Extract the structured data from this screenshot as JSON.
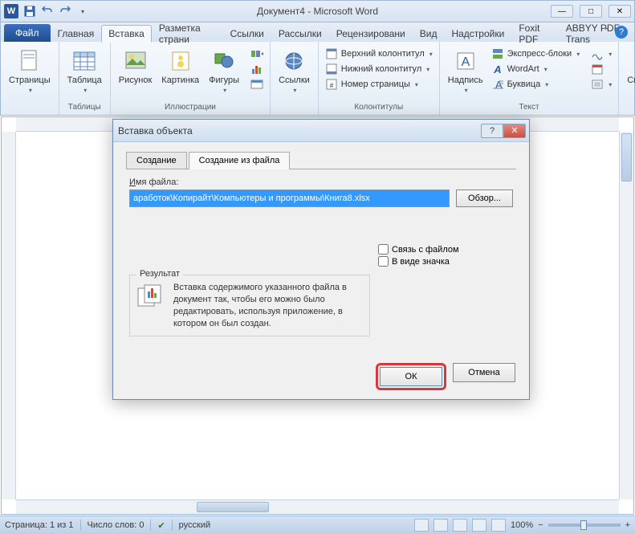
{
  "titlebar": {
    "app_letter": "W",
    "title": "Документ4 - Microsoft Word"
  },
  "tabs": {
    "file": "Файл",
    "items": [
      "Главная",
      "Вставка",
      "Разметка страни",
      "Ссылки",
      "Рассылки",
      "Рецензировани",
      "Вид",
      "Надстройки",
      "Foxit PDF",
      "ABBYY PDF Trans"
    ],
    "active_index": 1
  },
  "ribbon": {
    "groups": [
      {
        "label": "",
        "big": [
          {
            "label": "Страницы"
          }
        ]
      },
      {
        "label": "Таблицы",
        "big": [
          {
            "label": "Таблица"
          }
        ]
      },
      {
        "label": "Иллюстрации",
        "big": [
          {
            "label": "Рисунок"
          },
          {
            "label": "Картинка"
          },
          {
            "label": "Фигуры"
          }
        ],
        "small": []
      },
      {
        "label": "",
        "big": [
          {
            "label": "Ссылки"
          }
        ]
      },
      {
        "label": "Колонтитулы",
        "small": [
          "Верхний колонтитул",
          "Нижний колонтитул",
          "Номер страницы"
        ]
      },
      {
        "label": "Текст",
        "big": [
          {
            "label": "Надпись"
          }
        ],
        "small": [
          "Экспресс-блоки",
          "WordArt",
          "Буквица"
        ]
      },
      {
        "label": "",
        "big": [
          {
            "label": "Символы"
          }
        ]
      }
    ]
  },
  "dialog": {
    "title": "Вставка объекта",
    "tabs": [
      "Создание",
      "Создание из файла"
    ],
    "active_tab": 1,
    "filename_label": "Имя файла:",
    "filename_value": "аработок\\Копирайт\\Компьютеры и программы\\Книга8.xlsx",
    "browse": "Обзор...",
    "check_link": "Связь с файлом",
    "check_icon": "В виде значка",
    "result_label": "Результат",
    "result_text": "Вставка содержимого указанного файла в документ так, чтобы его можно было редактировать, используя приложение, в котором он был создан.",
    "ok": "ОК",
    "cancel": "Отмена"
  },
  "statusbar": {
    "page": "Страница: 1 из 1",
    "words": "Число слов: 0",
    "lang": "русский",
    "zoom": "100%"
  }
}
